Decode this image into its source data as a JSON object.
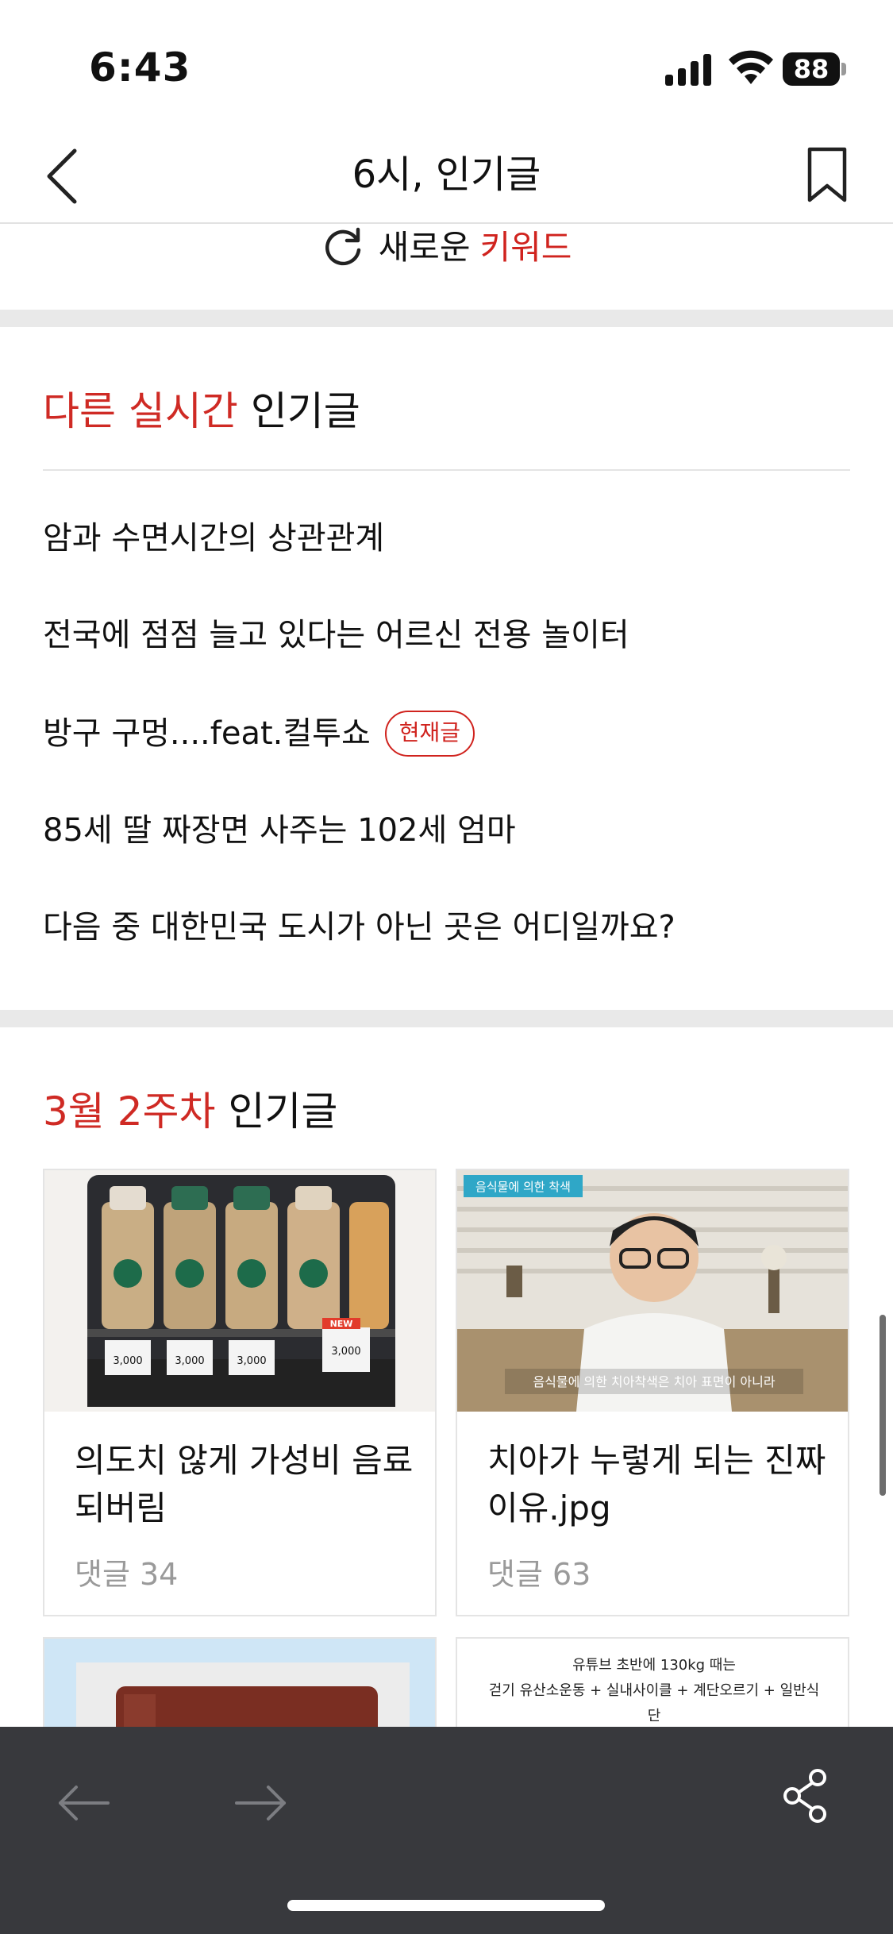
{
  "status_bar": {
    "time": "6:43",
    "battery": "88"
  },
  "header": {
    "title": "6시, 인기글",
    "back_icon": "chevron-left-icon",
    "bookmark_icon": "bookmark-icon"
  },
  "refresh": {
    "label": "새로운",
    "keyword": "키워드",
    "icon": "refresh-icon"
  },
  "realtime_section": {
    "title_highlight": "다른 실시간",
    "title_rest": "인기글",
    "items": [
      {
        "text": "암과 수면시간의 상관관계"
      },
      {
        "text": "전국에 점점 늘고 있다는 어르신 전용 놀이터"
      },
      {
        "text": "방구 구멍....feat.컬투쇼",
        "badge": "현재글"
      },
      {
        "text": "85세 딸 짜장면 사주는 102세 엄마"
      },
      {
        "text": "다음 중 대한민국 도시가 아닌 곳은 어디일까요?"
      }
    ]
  },
  "weekly_section": {
    "title_highlight": "3월 2주차",
    "title_rest": "인기글",
    "cards": [
      {
        "title": "의도치 않게 가성비 음료 되버림",
        "comments": "댓글 34",
        "price_tags": [
          "3,000",
          "3,000",
          "3,000",
          "3,000"
        ],
        "new_tag": "NEW"
      },
      {
        "title": "치아가 누렇게 되는 진짜 이유.jpg",
        "comments": "댓글 63",
        "overlay_top": "음식물에 의한 착색",
        "subtitle": "음식물에 의한 치아착색은 치아 표면이 아니라"
      },
      {
        "title": "",
        "comments": ""
      },
      {
        "title": "",
        "comments": "",
        "thumb_line1": "유튜브 초반에 130kg 때는",
        "thumb_line2": "걷기 유산소운동 + 실내사이클 + 계단오르기 + 일반식",
        "thumb_line3": "단"
      }
    ]
  },
  "toolbar": {
    "back_icon": "arrow-left-icon",
    "forward_icon": "arrow-right-icon",
    "share_icon": "share-icon"
  },
  "colors": {
    "accent": "#cf2a24",
    "toolbar": "#38393d",
    "divider": "#e9e9e9"
  }
}
